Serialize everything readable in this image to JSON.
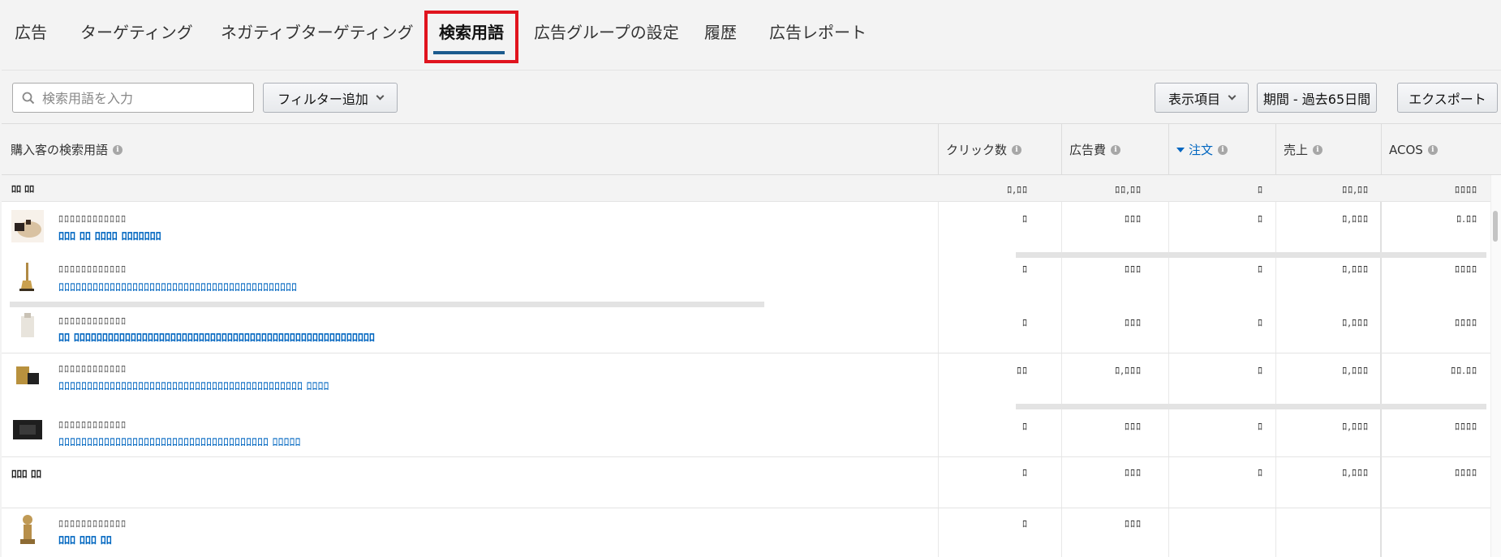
{
  "tabs": [
    {
      "label": "広告"
    },
    {
      "label": "ターゲティング"
    },
    {
      "label": "ネガティブターゲティング"
    },
    {
      "label": "検索用語"
    },
    {
      "label": "広告グループの設定"
    },
    {
      "label": "履歴"
    },
    {
      "label": "広告レポート"
    }
  ],
  "active_tab_index": 3,
  "highlight_color": "#e0141e",
  "accent_color": "#0066c0",
  "toolbar": {
    "search_placeholder": "検索用語を入力",
    "filter_button": "フィルター追加",
    "columns_button": "表示項目",
    "period_button": "期間 - 過去65日間",
    "export_button": "エクスポート"
  },
  "table": {
    "headers": {
      "term": "購入客の検索用語",
      "clicks": "クリック数",
      "spend": "広告費",
      "orders": "注文",
      "sales": "売上",
      "acos": "ACOS"
    },
    "sorted_column": "orders",
    "summary": {
      "label": "ﾛﾛ ﾛﾛ",
      "clicks": "ﾛ,ﾛﾛ",
      "spend": "ﾛﾛ,ﾛﾛ",
      "orders": "ﾛ",
      "sales": "ﾛﾛ,ﾛﾛ",
      "acos": "ﾛﾛﾛﾛ"
    },
    "rows": [
      {
        "thumb": "product-thumb-1",
        "asin": "ﾛﾛﾛﾛﾛﾛﾛﾛﾛﾛﾛﾛ",
        "term": "ﾛﾛﾛ ﾛﾛ ﾛﾛﾛﾛ ﾛﾛﾛﾛﾛﾛﾛ",
        "clicks": "ﾛ",
        "spend": "ﾛﾛﾛ",
        "orders": "ﾛ",
        "sales": "ﾛ,ﾛﾛﾛ",
        "acos": "ﾛ.ﾛﾛ"
      },
      {
        "thumb": "product-thumb-2",
        "asin": "ﾛﾛﾛﾛﾛﾛﾛﾛﾛﾛﾛﾛ",
        "term": "ﾛﾛﾛﾛﾛﾛﾛﾛﾛﾛﾛﾛﾛﾛﾛﾛﾛﾛﾛﾛﾛﾛﾛﾛﾛﾛﾛﾛﾛﾛﾛﾛﾛﾛﾛﾛﾛﾛﾛﾛﾛﾛ",
        "clicks": "ﾛ",
        "spend": "ﾛﾛﾛ",
        "orders": "ﾛ",
        "sales": "ﾛ,ﾛﾛﾛ",
        "acos": "ﾛﾛﾛﾛ"
      },
      {
        "thumb": "product-thumb-3",
        "asin": "ﾛﾛﾛﾛﾛﾛﾛﾛﾛﾛﾛﾛ",
        "term": "ﾛﾛ ﾛﾛﾛﾛﾛﾛﾛﾛﾛﾛﾛﾛﾛﾛﾛﾛﾛﾛﾛﾛﾛﾛﾛﾛﾛﾛﾛﾛﾛﾛﾛﾛﾛﾛﾛﾛﾛﾛﾛﾛﾛﾛﾛﾛﾛﾛﾛﾛﾛﾛﾛﾛﾛ",
        "clicks": "ﾛ",
        "spend": "ﾛﾛﾛ",
        "orders": "ﾛ",
        "sales": "ﾛ,ﾛﾛﾛ",
        "acos": "ﾛﾛﾛﾛ"
      },
      {
        "thumb": "product-thumb-4",
        "asin": "ﾛﾛﾛﾛﾛﾛﾛﾛﾛﾛﾛﾛ",
        "term": "ﾛﾛﾛﾛﾛﾛﾛﾛﾛﾛﾛﾛﾛﾛﾛﾛﾛﾛﾛﾛﾛﾛﾛﾛﾛﾛﾛﾛﾛﾛﾛﾛﾛﾛﾛﾛﾛﾛﾛﾛﾛﾛﾛ ﾛﾛﾛﾛ",
        "clicks": "ﾛﾛ",
        "spend": "ﾛ,ﾛﾛﾛ",
        "orders": "ﾛ",
        "sales": "ﾛ,ﾛﾛﾛ",
        "acos": "ﾛﾛ.ﾛﾛ"
      },
      {
        "thumb": "product-thumb-5",
        "asin": "ﾛﾛﾛﾛﾛﾛﾛﾛﾛﾛﾛﾛ",
        "term": "ﾛﾛﾛﾛﾛﾛﾛﾛﾛﾛﾛﾛﾛﾛﾛﾛﾛﾛﾛﾛﾛﾛﾛﾛﾛﾛﾛﾛﾛﾛﾛﾛﾛﾛﾛﾛﾛ ﾛﾛﾛﾛﾛ",
        "clicks": "ﾛ",
        "spend": "ﾛﾛﾛ",
        "orders": "ﾛ",
        "sales": "ﾛ,ﾛﾛﾛ",
        "acos": "ﾛﾛﾛﾛ"
      },
      {
        "thumb": "",
        "asin": "",
        "term": "",
        "plain": "ﾛﾛﾛ ﾛﾛ",
        "clicks": "ﾛ",
        "spend": "ﾛﾛﾛ",
        "orders": "ﾛ",
        "sales": "ﾛ,ﾛﾛﾛ",
        "acos": "ﾛﾛﾛﾛ"
      },
      {
        "thumb": "product-thumb-6",
        "asin": "ﾛﾛﾛﾛﾛﾛﾛﾛﾛﾛﾛﾛ",
        "term": "ﾛﾛﾛ ﾛﾛﾛ ﾛﾛ",
        "clicks": "ﾛ",
        "spend": "ﾛﾛﾛ",
        "orders": "",
        "sales": "",
        "acos": ""
      }
    ]
  }
}
